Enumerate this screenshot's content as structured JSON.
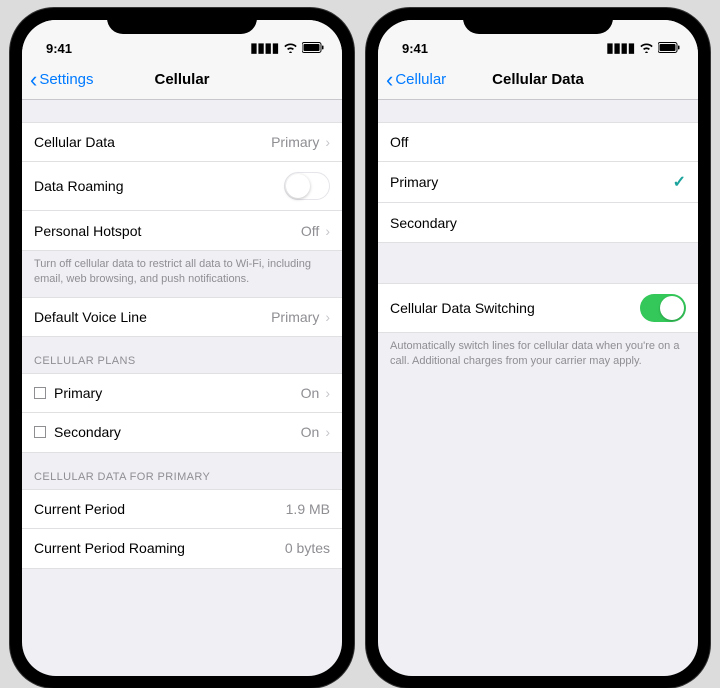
{
  "status": {
    "time": "9:41"
  },
  "left": {
    "back": "Settings",
    "title": "Cellular",
    "cellularData": {
      "label": "Cellular Data",
      "value": "Primary"
    },
    "dataRoaming": {
      "label": "Data Roaming",
      "on": false
    },
    "hotspot": {
      "label": "Personal Hotspot",
      "value": "Off"
    },
    "note": "Turn off cellular data to restrict all data to Wi-Fi, including email, web browsing, and push notifications.",
    "defaultVoice": {
      "label": "Default Voice Line",
      "value": "Primary"
    },
    "plansHeader": "CELLULAR PLANS",
    "plans": [
      {
        "name": "Primary",
        "value": "On"
      },
      {
        "name": "Secondary",
        "value": "On"
      }
    ],
    "usageHeader": "CELLULAR DATA FOR PRIMARY",
    "usage": [
      {
        "label": "Current Period",
        "value": "1.9 MB"
      },
      {
        "label": "Current Period Roaming",
        "value": "0 bytes"
      }
    ]
  },
  "right": {
    "back": "Cellular",
    "title": "Cellular Data",
    "options": [
      {
        "label": "Off",
        "selected": false
      },
      {
        "label": "Primary",
        "selected": true
      },
      {
        "label": "Secondary",
        "selected": false
      }
    ],
    "switching": {
      "label": "Cellular Data Switching",
      "on": true
    },
    "note": "Automatically switch lines for cellular data when you're on a call. Additional charges from your carrier may apply."
  }
}
